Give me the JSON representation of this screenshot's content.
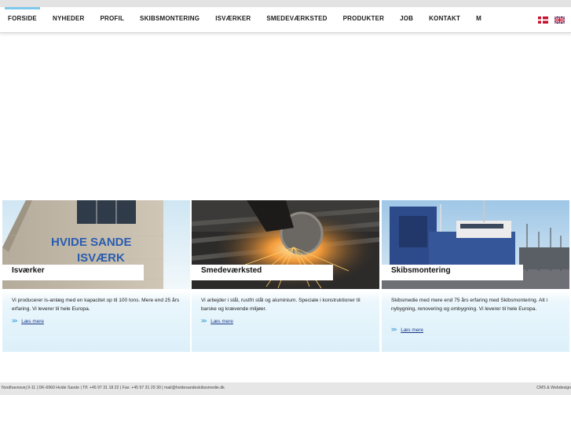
{
  "nav": {
    "items": [
      {
        "label": "FORSIDE",
        "active": true
      },
      {
        "label": "NYHEDER"
      },
      {
        "label": "PROFIL"
      },
      {
        "label": "SKIBSMONTERING"
      },
      {
        "label": "ISVÆRKER"
      },
      {
        "label": "SMEDEVÆRKSTED"
      },
      {
        "label": "PRODUKTER"
      },
      {
        "label": "JOB"
      },
      {
        "label": "KONTAKT"
      },
      {
        "label": "M"
      }
    ],
    "languages": [
      "danish-flag-icon",
      "english-flag-icon"
    ]
  },
  "cards": [
    {
      "title": "Isværker",
      "text": "Vi producerer is-anlæg med en kapacitet op til 100 tons. Mere end 25 års erfaring. Vi leverer til hele Europa.",
      "more": "Læs mere",
      "image_sign": [
        "HVIDE SANDE",
        "ISVÆRK"
      ]
    },
    {
      "title": "Smedeværksted",
      "text": "Vi arbejder i stål, rustfri stål og aluminium. Speciale i konstruktioner til barske og krævende miljøer.",
      "more": "Læs mere"
    },
    {
      "title": "Skibsmontering",
      "text": "Skibsmedie med mere end 75 års erfaring med Skibsmontering. Alt i nybygning, renovering og ombygning. Vi leverer til hele Europa.",
      "more": "Læs mere"
    }
  ],
  "footer": {
    "address": "Nordhavnsvej 9-11  |  DK-6960 Hvide Sande  |  Tlf: +45 97 31 18 22  |  Fax: +45 97 31 29 30  |  mail@hvidesandeskibssmedie.dk",
    "credit": "CMS & Webdesign"
  },
  "colors": {
    "accent": "#7ec8ec",
    "link": "#1a3a8a",
    "chevron": "#3a9bd6",
    "card_gradient": "#dcf0fa",
    "footer_bg": "#e6e6e6"
  }
}
